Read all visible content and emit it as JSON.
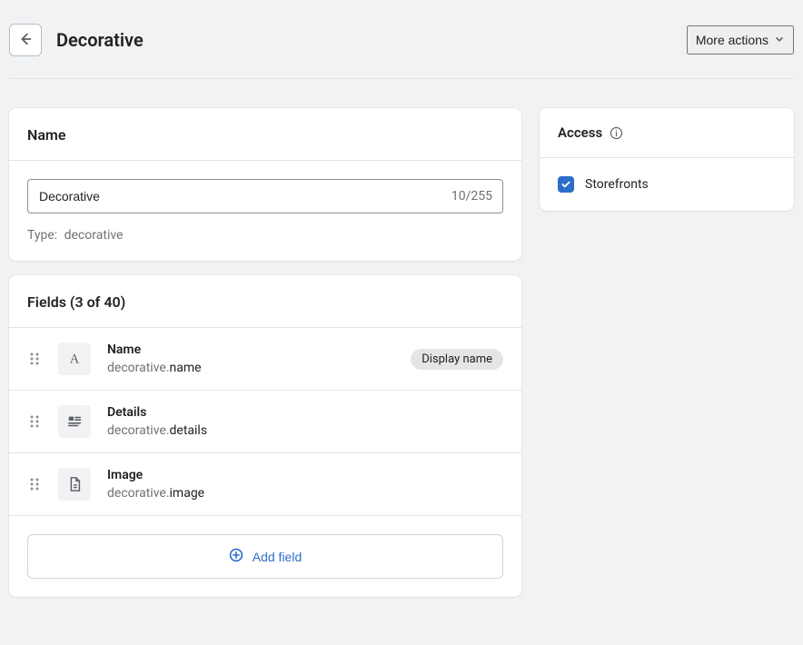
{
  "header": {
    "title": "Decorative",
    "more_actions_label": "More actions"
  },
  "name_card": {
    "title": "Name",
    "input_value": "Decorative",
    "char_count": "10/255",
    "type_label": "Type:",
    "type_value": "decorative"
  },
  "fields_card": {
    "title": "Fields (3 of 40)",
    "fields": [
      {
        "name": "Name",
        "path_prefix": "decorative.",
        "path_suffix": "name",
        "badge": "Display name"
      },
      {
        "name": "Details",
        "path_prefix": "decorative.",
        "path_suffix": "details",
        "badge": null
      },
      {
        "name": "Image",
        "path_prefix": "decorative.",
        "path_suffix": "image",
        "badge": null
      }
    ],
    "add_field_label": "Add field"
  },
  "access_card": {
    "title": "Access",
    "storefronts_label": "Storefronts",
    "storefronts_checked": true
  }
}
